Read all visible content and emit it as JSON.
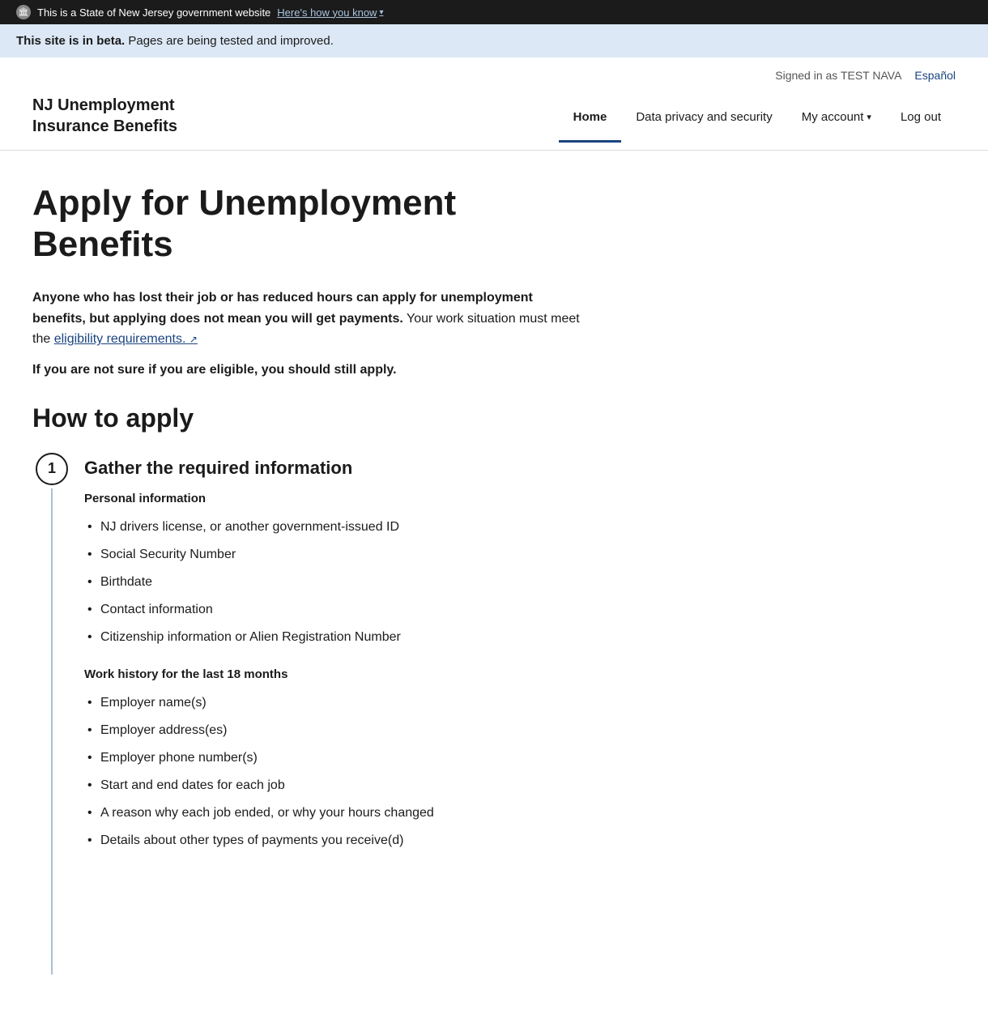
{
  "gov_banner": {
    "seal_label": "🏛",
    "text": "This is a State of New Jersey government website",
    "how_know_label": "Here's how you know",
    "chevron": "▾"
  },
  "beta_banner": {
    "bold_text": "This site is in beta.",
    "text": " Pages are being tested and improved."
  },
  "header": {
    "signed_in_text": "Signed in as TEST NAVA",
    "espanol_label": "Español",
    "site_title_line1": "NJ Unemployment",
    "site_title_line2": "Insurance Benefits",
    "nav": [
      {
        "id": "home",
        "label": "Home",
        "active": true
      },
      {
        "id": "data-privacy",
        "label": "Data privacy and security",
        "active": false
      },
      {
        "id": "my-account",
        "label": "My account",
        "active": false,
        "has_dropdown": true
      },
      {
        "id": "log-out",
        "label": "Log out",
        "active": false
      }
    ]
  },
  "main": {
    "page_title": "Apply for Unemployment Benefits",
    "intro_bold": "Anyone who has lost their job or has reduced hours can apply for unemployment benefits, but applying does not mean you will get payments.",
    "intro_rest": " Your work situation must meet the ",
    "eligibility_link": "eligibility requirements.",
    "note": "If you are not sure if you are eligible, you should still apply.",
    "how_to_apply_heading": "How to apply",
    "step1": {
      "number": "1",
      "heading": "Gather the required information",
      "personal_info_heading": "Personal information",
      "personal_items": [
        "NJ drivers license, or another government-issued ID",
        "Social Security Number",
        "Birthdate",
        "Contact information",
        "Citizenship information or Alien Registration Number"
      ],
      "work_history_heading": "Work history for the last 18 months",
      "work_items": [
        "Employer name(s)",
        "Employer address(es)",
        "Employer phone number(s)",
        "Start and end dates for each job",
        "A reason why each job ended, or why your hours changed",
        "Details about other types of payments you receive(d)"
      ]
    }
  }
}
